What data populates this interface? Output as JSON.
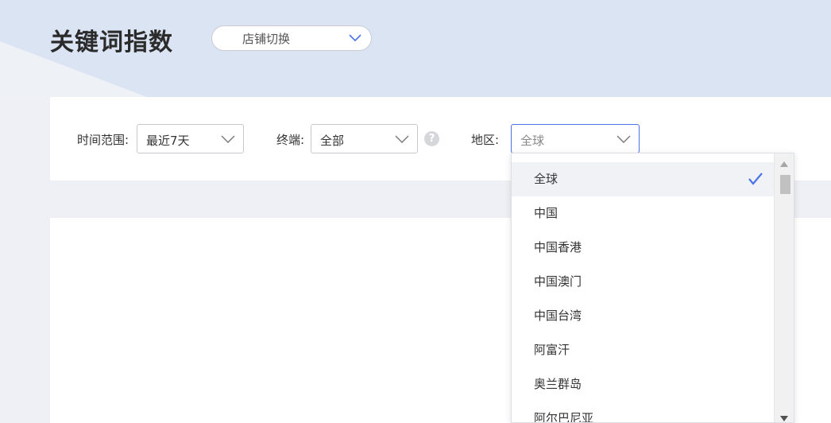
{
  "header": {
    "title": "关键词指数",
    "shop_switch": {
      "label": "店铺切换",
      "icon": "chevron-down-icon"
    }
  },
  "filters": {
    "time": {
      "label": "时间范围:",
      "value": "最近7天"
    },
    "terminal": {
      "label": "终端:",
      "value": "全部",
      "help_icon": "question-icon"
    },
    "region": {
      "label": "地区:",
      "placeholder": "全球",
      "selected": "全球"
    }
  },
  "region_dropdown": {
    "options": [
      "全球",
      "中国",
      "中国香港",
      "中国澳门",
      "中国台湾",
      "阿富汗",
      "奥兰群岛",
      "阿尔巴尼亚"
    ],
    "selected_index": 0,
    "check_icon": "checkmark-icon"
  },
  "colors": {
    "banner": "#dbe4f3",
    "accent": "#4a74e8",
    "page_bg": "#eef0f5"
  }
}
